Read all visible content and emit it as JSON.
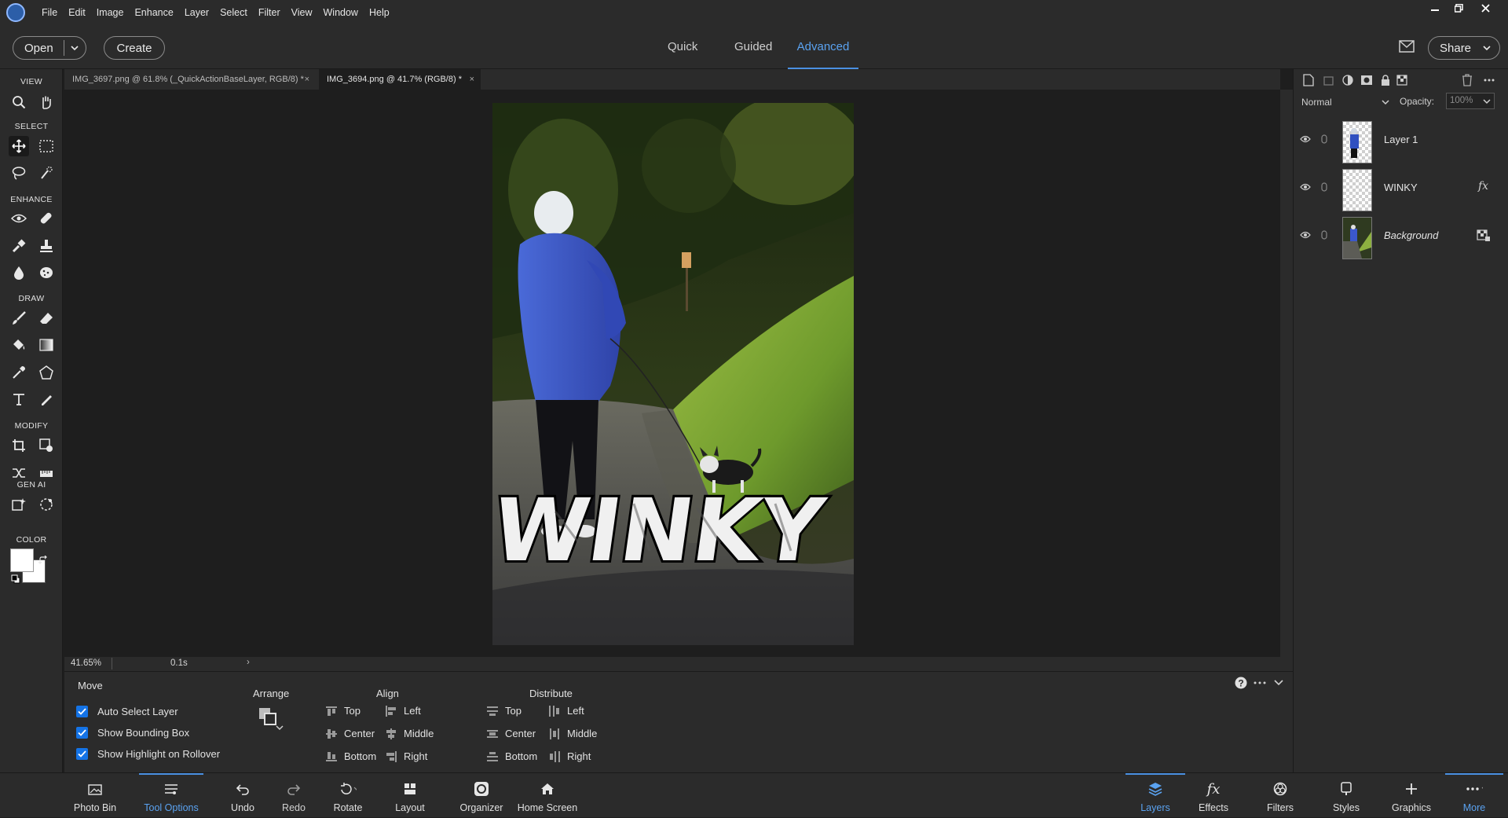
{
  "menubar": {
    "items": [
      "File",
      "Edit",
      "Image",
      "Enhance",
      "Layer",
      "Select",
      "Filter",
      "View",
      "Window",
      "Help"
    ]
  },
  "topbar": {
    "open_label": "Open",
    "create_label": "Create",
    "modes": [
      "Quick",
      "Guided",
      "Advanced"
    ],
    "active_mode": "Advanced",
    "share_label": "Share"
  },
  "toolbar": {
    "sections": {
      "view": "VIEW",
      "select": "SELECT",
      "enhance": "ENHANCE",
      "draw": "DRAW",
      "modify": "MODIFY",
      "genai": "GEN AI",
      "color": "COLOR"
    }
  },
  "tabs": [
    {
      "label": "IMG_3697.png @ 61.8% (_QuickActionBaseLayer, RGB/8) *",
      "close": "×"
    },
    {
      "label": "IMG_3694.png @ 41.7% (RGB/8) *",
      "close": "×"
    }
  ],
  "canvas": {
    "overlay_text": "WINKY",
    "sign_text": ""
  },
  "status": {
    "zoom": "41.65%",
    "timing": "0.1s",
    "arrow": "›"
  },
  "layers_panel": {
    "blend_mode": "Normal",
    "opacity_label": "Opacity:",
    "opacity_value": "100%",
    "layers": [
      {
        "name": "Layer 1",
        "fx": ""
      },
      {
        "name": "WINKY",
        "fx": "fx"
      },
      {
        "name": "Background",
        "fx": ""
      }
    ]
  },
  "tool_options": {
    "tool_name": "Move",
    "checkboxes": [
      "Auto Select Layer",
      "Show Bounding Box",
      "Show Highlight on Rollover"
    ],
    "arrange_label": "Arrange",
    "align_label": "Align",
    "align_col1": [
      "Top",
      "Center",
      "Bottom"
    ],
    "align_col2": [
      "Left",
      "Middle",
      "Right"
    ],
    "distribute_label": "Distribute",
    "distribute_col1": [
      "Top",
      "Center",
      "Bottom"
    ],
    "distribute_col2": [
      "Left",
      "Middle",
      "Right"
    ]
  },
  "bottombar": {
    "left": [
      "Photo Bin",
      "Tool Options",
      "Undo",
      "Redo",
      "Rotate",
      "Layout",
      "Organizer",
      "Home Screen"
    ],
    "right": [
      "Layers",
      "Effects",
      "Filters",
      "Styles",
      "Graphics",
      "More"
    ]
  },
  "colors": {
    "accent": "#4a90e2",
    "checkbox": "#1473e6",
    "panel": "#2b2b2b",
    "canvas_bg": "#1e1e1e"
  }
}
